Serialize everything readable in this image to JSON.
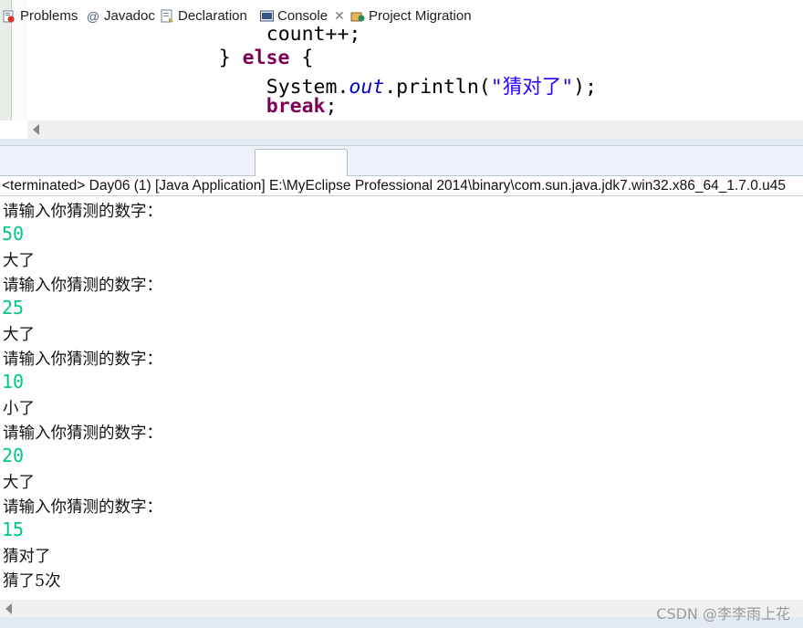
{
  "editor": {
    "lines": {
      "l1": {
        "text": "count++;"
      },
      "l2": {
        "brace_close": "} ",
        "kw": "else",
        "brace_open": " {"
      },
      "l3": {
        "sys": "System.",
        "field": "out",
        "method": ".println(",
        "str_open": "\"",
        "str_cn": "猜对了",
        "str_close": "\"",
        "end": ");"
      },
      "l4": {
        "kw": "break",
        "end": ";"
      },
      "l5": {
        "text": "}"
      }
    }
  },
  "tabs": {
    "problems": "Problems",
    "javadoc": "Javadoc",
    "declaration": "Declaration",
    "console": "Console",
    "console_close": "✕",
    "migration": "Project Migration"
  },
  "console": {
    "header": "<terminated> Day06 (1) [Java Application] E:\\MyEclipse Professional 2014\\binary\\com.sun.java.jdk7.win32.x86_64_1.7.0.u45",
    "output": [
      {
        "kind": "out",
        "text": "请输入你猜测的数字："
      },
      {
        "kind": "in",
        "text": "50"
      },
      {
        "kind": "out",
        "text": "大了"
      },
      {
        "kind": "out",
        "text": "请输入你猜测的数字："
      },
      {
        "kind": "in",
        "text": "25"
      },
      {
        "kind": "out",
        "text": "大了"
      },
      {
        "kind": "out",
        "text": "请输入你猜测的数字："
      },
      {
        "kind": "in",
        "text": "10"
      },
      {
        "kind": "out",
        "text": "小了"
      },
      {
        "kind": "out",
        "text": "请输入你猜测的数字："
      },
      {
        "kind": "in",
        "text": "20"
      },
      {
        "kind": "out",
        "text": "大了"
      },
      {
        "kind": "out",
        "text": "请输入你猜测的数字："
      },
      {
        "kind": "in",
        "text": "15"
      },
      {
        "kind": "out",
        "text": "猜对了"
      },
      {
        "kind": "out",
        "text": "猜了5次"
      }
    ]
  },
  "watermark": "CSDN @李李雨上花",
  "colors": {
    "keyword": "#7f0055",
    "field": "#0000c0",
    "string": "#2a00ff",
    "user_input": "#00c87f"
  }
}
